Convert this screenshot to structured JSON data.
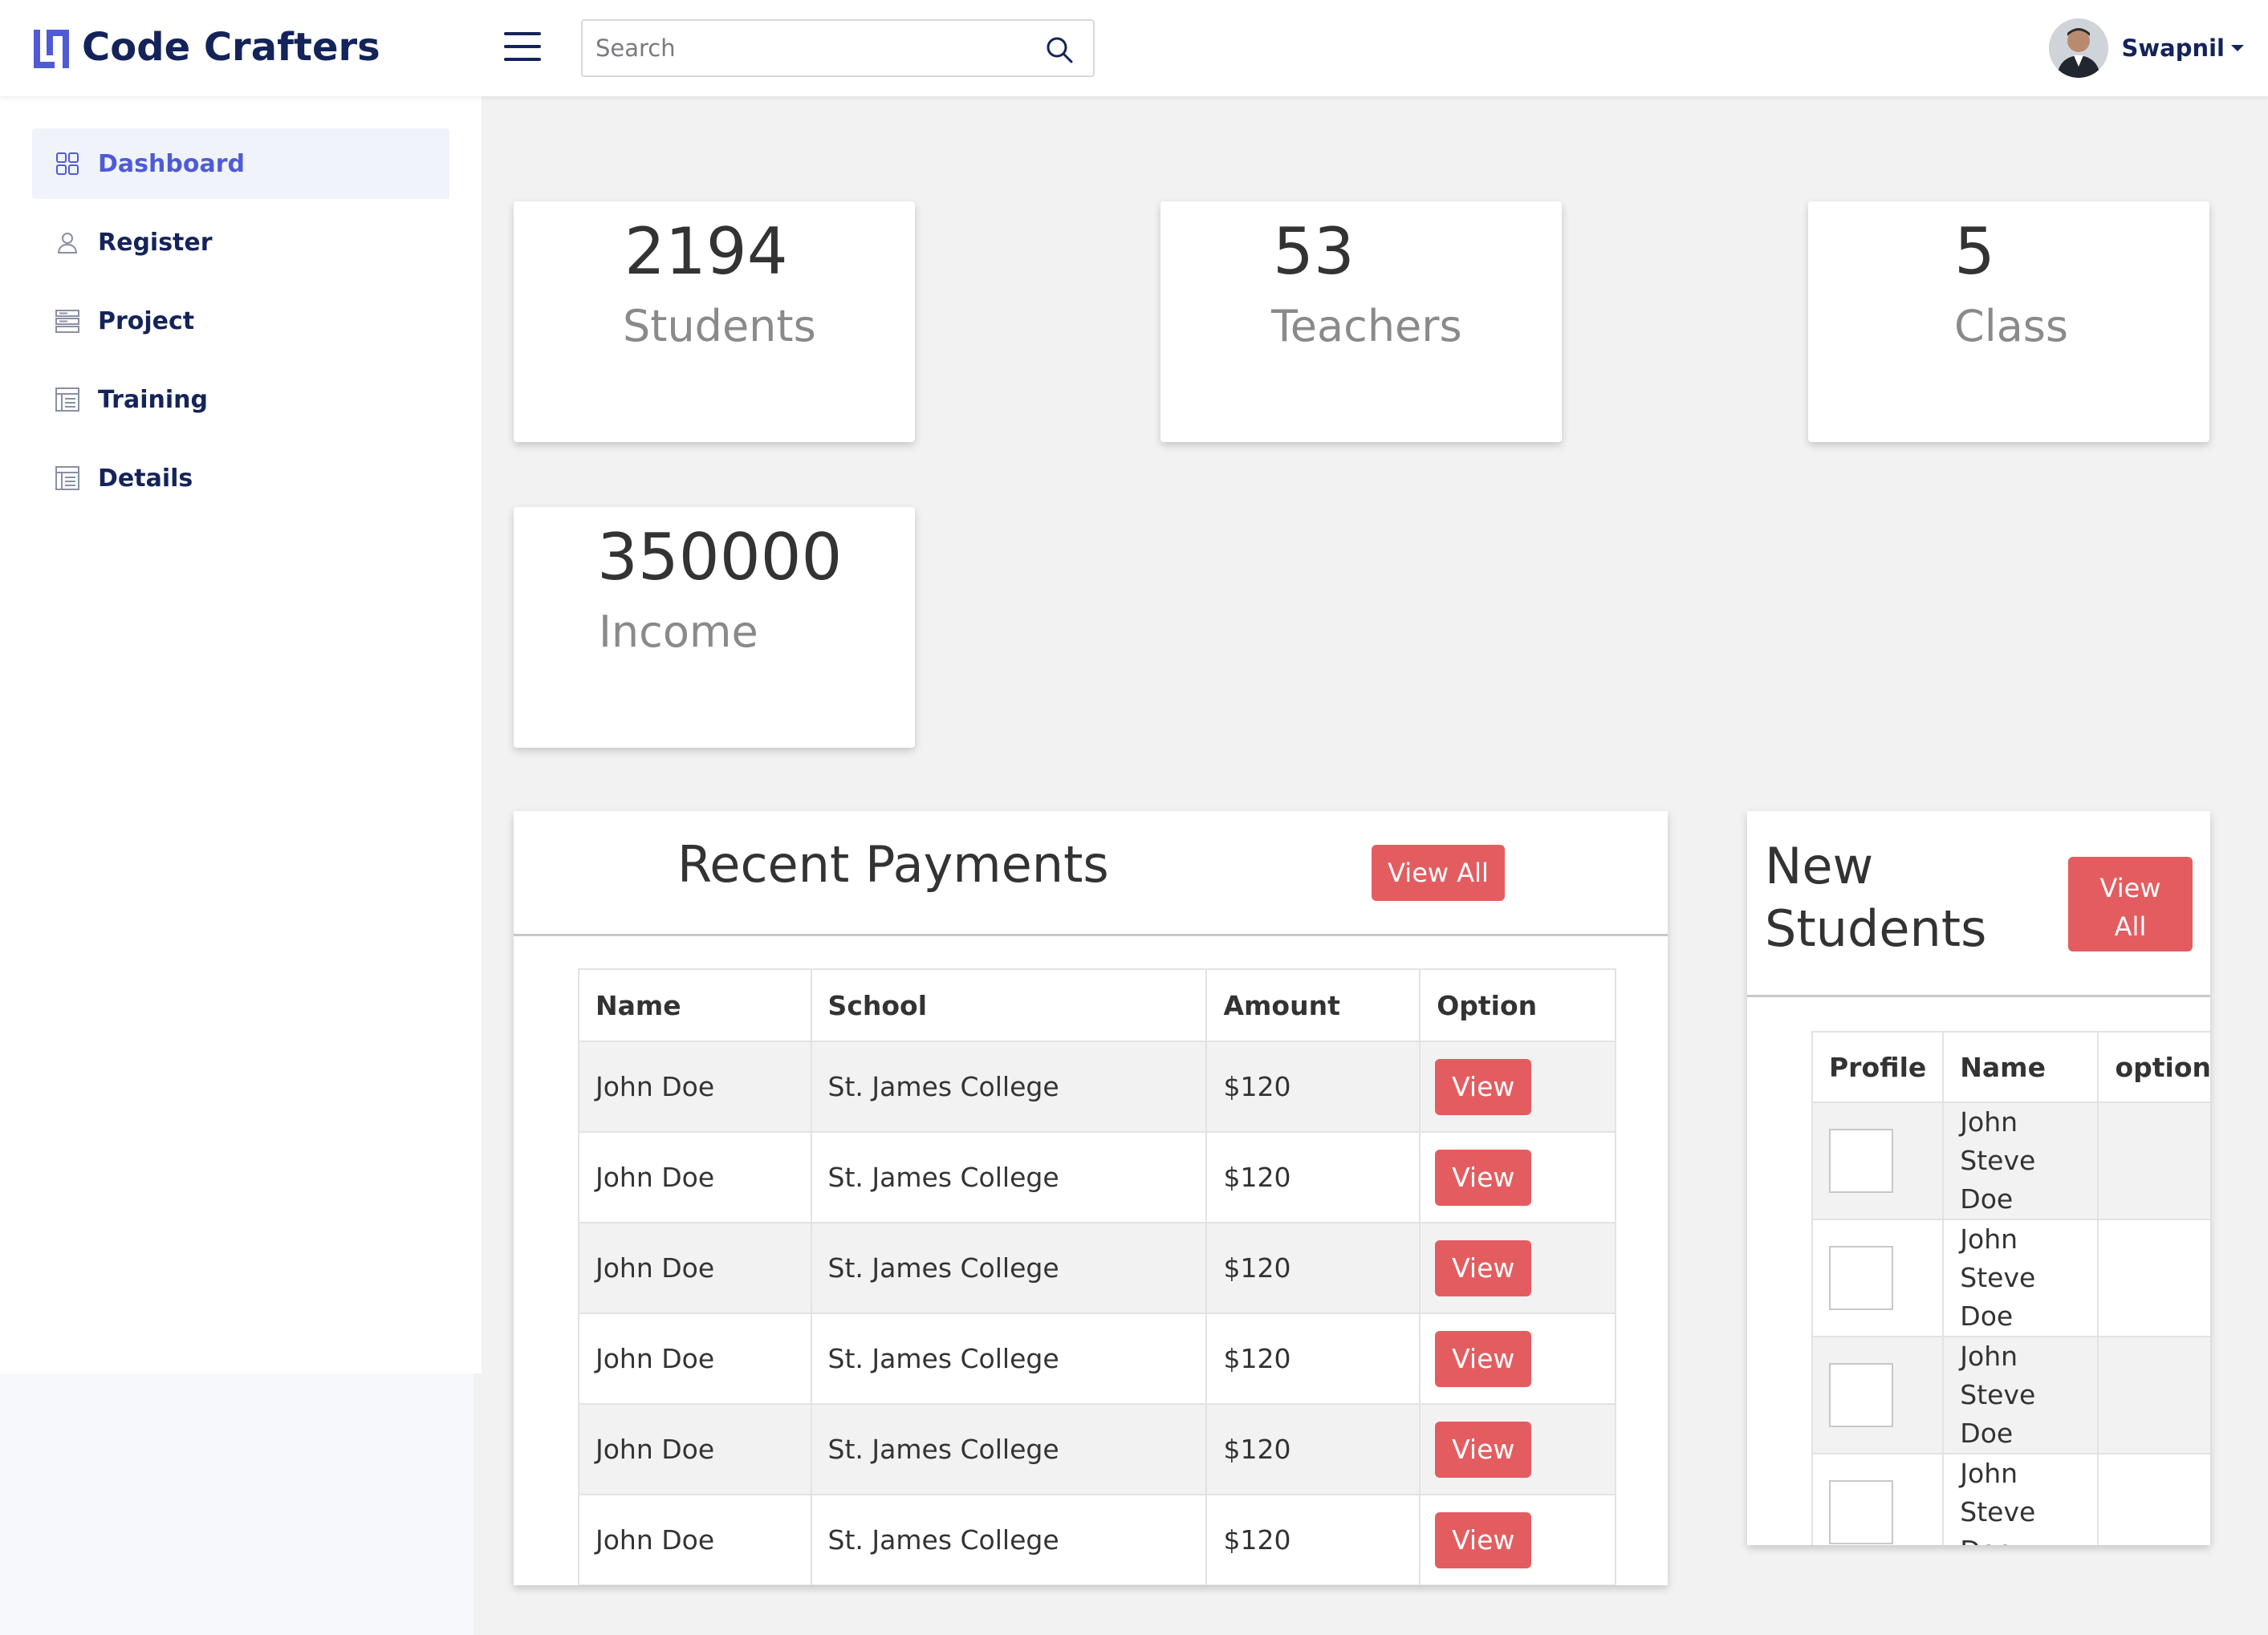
{
  "header": {
    "brand": "Code Crafters",
    "search_placeholder": "Search",
    "user_name": "Swapnil"
  },
  "sidebar": {
    "items": [
      {
        "label": "Dashboard",
        "icon": "grid-icon",
        "active": true
      },
      {
        "label": "Register",
        "icon": "user-icon",
        "active": false
      },
      {
        "label": "Project",
        "icon": "server-icon",
        "active": false
      },
      {
        "label": "Training",
        "icon": "list-icon",
        "active": false
      },
      {
        "label": "Details",
        "icon": "list-icon",
        "active": false
      }
    ]
  },
  "stats": [
    {
      "value": "2194",
      "label": "Students"
    },
    {
      "value": "53",
      "label": "Teachers"
    },
    {
      "value": "5",
      "label": "Class"
    },
    {
      "value": "350000",
      "label": "Income"
    }
  ],
  "payments": {
    "title": "Recent Payments",
    "view_all": "View All",
    "columns": [
      "Name",
      "School",
      "Amount",
      "Option"
    ],
    "rows": [
      {
        "name": "John Doe",
        "school": "St. James College",
        "amount": "$120",
        "action": "View"
      },
      {
        "name": "John Doe",
        "school": "St. James College",
        "amount": "$120",
        "action": "View"
      },
      {
        "name": "John Doe",
        "school": "St. James College",
        "amount": "$120",
        "action": "View"
      },
      {
        "name": "John Doe",
        "school": "St. James College",
        "amount": "$120",
        "action": "View"
      },
      {
        "name": "John Doe",
        "school": "St. James College",
        "amount": "$120",
        "action": "View"
      },
      {
        "name": "John Doe",
        "school": "St. James College",
        "amount": "$120",
        "action": "View"
      }
    ]
  },
  "new_students": {
    "title_line1": "New",
    "title_line2": "Students",
    "view_all_line1": "View",
    "view_all_line2": "All",
    "columns": [
      "Profile",
      "Name",
      "option"
    ],
    "rows": [
      {
        "name_line1": "John Steve",
        "name_line2": "Doe"
      },
      {
        "name_line1": "John Steve",
        "name_line2": "Doe"
      },
      {
        "name_line1": "John Steve",
        "name_line2": "Doe"
      },
      {
        "name_line1": "John Steve",
        "name_line2": "Doe"
      }
    ]
  },
  "colors": {
    "brand": "#14245a",
    "accent": "#4f5bd5",
    "button": "#e35d60"
  }
}
